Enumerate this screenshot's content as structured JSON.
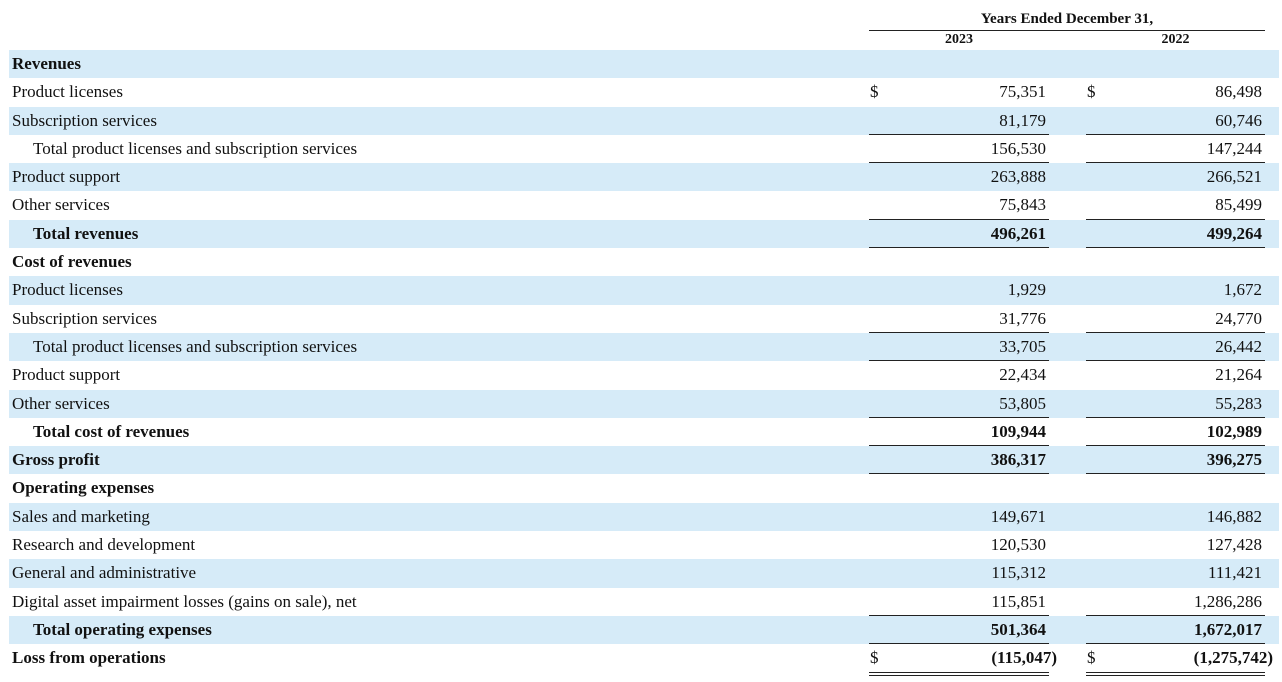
{
  "header": {
    "period": "Years Ended December 31,",
    "years": [
      "2023",
      "2022"
    ]
  },
  "rows": [
    {
      "label": "Revenues",
      "type": "section",
      "v2023": "",
      "v2022": ""
    },
    {
      "label": "Product licenses",
      "type": "item",
      "dollar": "$",
      "v2023": "75,351",
      "v2022": "86,498"
    },
    {
      "label": "Subscription services",
      "type": "item",
      "v2023": "81,179",
      "v2022": "60,746"
    },
    {
      "label": "Total product licenses and subscription services",
      "type": "subtotal",
      "v2023": "156,530",
      "v2022": "147,244"
    },
    {
      "label": "Product support",
      "type": "item",
      "v2023": "263,888",
      "v2022": "266,521"
    },
    {
      "label": "Other services",
      "type": "item",
      "v2023": "75,843",
      "v2022": "85,499"
    },
    {
      "label": "Total revenues",
      "type": "total",
      "v2023": "496,261",
      "v2022": "499,264"
    },
    {
      "label": "Cost of revenues",
      "type": "section",
      "v2023": "",
      "v2022": ""
    },
    {
      "label": "Product licenses",
      "type": "item",
      "v2023": "1,929",
      "v2022": "1,672"
    },
    {
      "label": "Subscription services",
      "type": "item",
      "v2023": "31,776",
      "v2022": "24,770"
    },
    {
      "label": "Total product licenses and subscription services",
      "type": "subtotal",
      "v2023": "33,705",
      "v2022": "26,442"
    },
    {
      "label": "Product support",
      "type": "item",
      "v2023": "22,434",
      "v2022": "21,264"
    },
    {
      "label": "Other services",
      "type": "item",
      "v2023": "53,805",
      "v2022": "55,283"
    },
    {
      "label": "Total cost of revenues",
      "type": "total",
      "v2023": "109,944",
      "v2022": "102,989"
    },
    {
      "label": "Gross profit",
      "type": "grand",
      "v2023": "386,317",
      "v2022": "396,275"
    },
    {
      "label": "Operating expenses",
      "type": "section",
      "v2023": "",
      "v2022": ""
    },
    {
      "label": "Sales and marketing",
      "type": "item",
      "v2023": "149,671",
      "v2022": "146,882"
    },
    {
      "label": "Research and development",
      "type": "item",
      "v2023": "120,530",
      "v2022": "127,428"
    },
    {
      "label": "General and administrative",
      "type": "item",
      "v2023": "115,312",
      "v2022": "111,421"
    },
    {
      "label": "Digital asset impairment losses (gains on sale), net",
      "type": "item",
      "v2023": "115,851",
      "v2022": "1,286,286"
    },
    {
      "label": "Total operating expenses",
      "type": "total",
      "v2023": "501,364",
      "v2022": "1,672,017"
    },
    {
      "label": "Loss from operations",
      "type": "final",
      "dollar": "$",
      "v2023": "(115,047)",
      "v2022": "(1,275,742)"
    }
  ]
}
